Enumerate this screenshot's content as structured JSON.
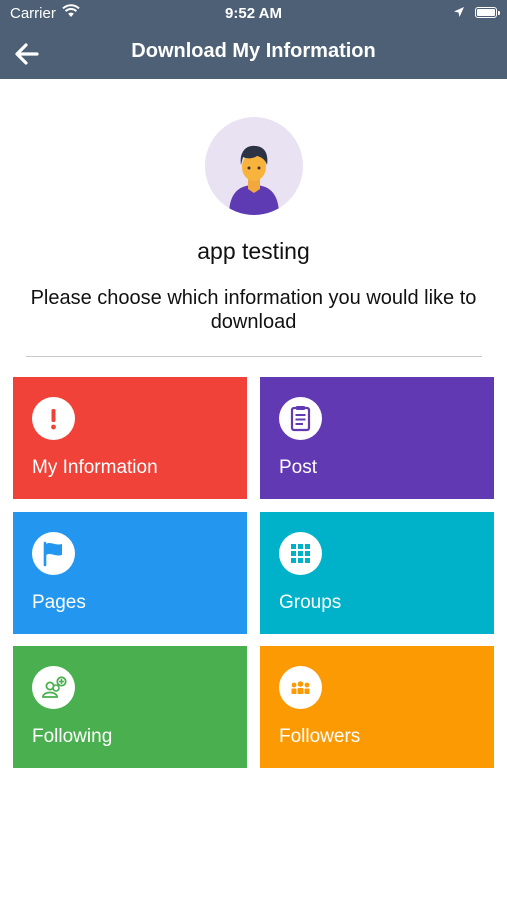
{
  "status_bar": {
    "carrier": "Carrier",
    "time": "9:52 AM"
  },
  "header": {
    "title": "Download My Information",
    "back_icon": "arrow-left-icon"
  },
  "profile": {
    "name": "app testing",
    "avatar_icon": "user-avatar"
  },
  "prompt": "Please choose which information you would like to download",
  "tiles": [
    {
      "label": "My Information",
      "color": "#f04238",
      "icon": "exclamation-icon"
    },
    {
      "label": "Post",
      "color": "#6139b2",
      "icon": "clipboard-icon"
    },
    {
      "label": "Pages",
      "color": "#2396ef",
      "icon": "flag-icon"
    },
    {
      "label": "Groups",
      "color": "#00b2c9",
      "icon": "grid-icon"
    },
    {
      "label": "Following",
      "color": "#4aaf4f",
      "icon": "add-friend-icon"
    },
    {
      "label": "Followers",
      "color": "#fc9a04",
      "icon": "group-icon"
    }
  ]
}
